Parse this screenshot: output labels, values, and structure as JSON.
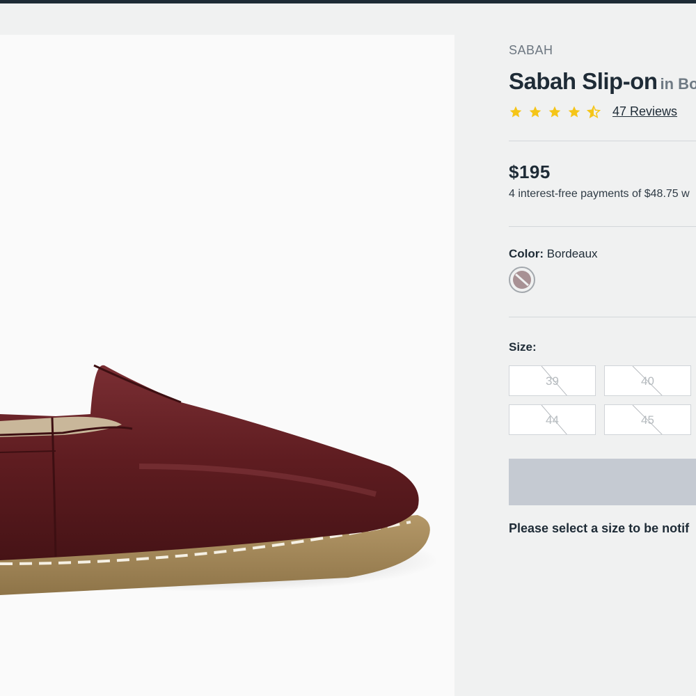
{
  "product": {
    "brand": "SABAH",
    "title": "Sabah Slip-on",
    "title_color_suffix": "in Bo",
    "rating": 4.5,
    "rating_max": 5,
    "reviews_label": "47 Reviews",
    "price": "$195",
    "installments": "4 interest-free payments of $48.75 w",
    "color_label": "Color:",
    "color_value": "Bordeaux",
    "size_label": "Size:",
    "sizes": [
      {
        "label": "39",
        "available": false
      },
      {
        "label": "40",
        "available": false
      },
      {
        "label": "44",
        "available": false
      },
      {
        "label": "45",
        "available": false
      }
    ],
    "notify_text": "Please select a size to be notif"
  },
  "colors": {
    "top_bar": "#1e2b36",
    "star": "#f5c518",
    "text_primary": "#1e2b36",
    "button_disabled": "#c5cad2",
    "swatch": "#a89194",
    "leather": "#5e1c20"
  },
  "icons": {
    "star": "star-icon",
    "half_star": "star-half-icon",
    "swatch_unavailable": "slash-circle-icon"
  }
}
